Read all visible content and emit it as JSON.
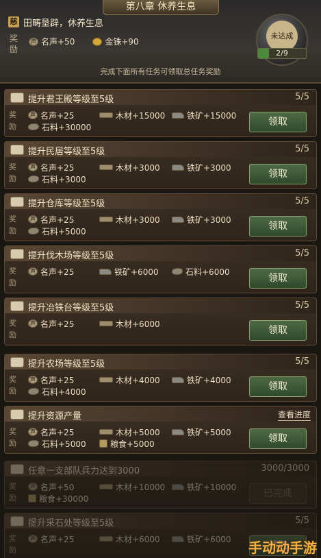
{
  "header": {
    "chapter_title": "第八章  休养生息",
    "tag_glyph": "慈",
    "subtitle": "田畴垦辟，休养生息",
    "reward_label": "奖励",
    "rewards": [
      {
        "icon": "fame-icon",
        "text": "名声+50"
      },
      {
        "icon": "gold-icon",
        "text": "金铢+90"
      }
    ],
    "note": "完成下面所有任务可领取总任务奖励",
    "orb_label": "未达成",
    "progress_text": "2/9",
    "progress_value": 0.222
  },
  "reward_label": "奖励",
  "claim_label": "领取",
  "tasks": [
    {
      "title": "提升君王殿等级至5级",
      "count": "5/5",
      "rewards": [
        "名声+25",
        "木材+15000",
        "铁矿+15000",
        "石料+30000"
      ]
    },
    {
      "title": "提升民居等级至5级",
      "count": "5/5",
      "rewards": [
        "名声+25",
        "木材+3000",
        "铁矿+3000",
        "石料+3000"
      ]
    },
    {
      "title": "提升仓库等级至5级",
      "count": "5/5",
      "rewards": [
        "名声+25",
        "木材+3000",
        "铁矿+3000",
        "石料+5000"
      ]
    },
    {
      "title": "提升伐木场等级至5级",
      "count": "5/5",
      "rewards": [
        "名声+25",
        "铁矿+6000",
        "石料+6000"
      ]
    },
    {
      "title": "提升冶铁台等级至5级",
      "count": "5/5",
      "rewards": [
        "名声+25",
        "木材+6000",
        ""
      ]
    },
    {
      "title": "提升农场等级至5级",
      "count": "5/5",
      "rewards": [
        "名声+25",
        "木材+4000",
        "铁矿+4000",
        "石料+4000"
      ]
    },
    {
      "title": "提升资源产量",
      "link": "查看进度",
      "rewards": [
        "名声+25",
        "木材+5000",
        "铁矿+5000",
        "石料+5000",
        "粮食+5000"
      ]
    },
    {
      "title": "任意一支部队兵力达到3000",
      "count": "3000/3000",
      "rewards": [
        "名声+50",
        "木材+10000",
        "铁矿+10000",
        "粮食+30000"
      ],
      "button": "已完成"
    },
    {
      "title": "提升采石处等级至5级",
      "count": "5/5",
      "rewards": [
        "名声+25",
        "木材+6000",
        "铁矿+6000"
      ]
    }
  ],
  "watermark": "手动动手游",
  "colors": {
    "claim_button": "#3f5a38",
    "panel": "#3c3024",
    "accent": "#c9a050"
  }
}
